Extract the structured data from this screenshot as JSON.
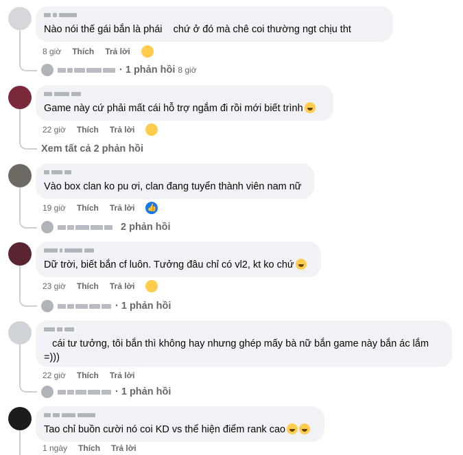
{
  "comments": [
    {
      "text": "Nào nói thế gái bắn là phái    chứ ở đó mà chê coi thường ngt chịu tht",
      "time": "8 giờ",
      "like": "Thích",
      "reply": "Trả lời",
      "reply_count": "· 1 phản hồi",
      "reply_time": "8 giờ",
      "reaction": "sad-cry-emoji"
    },
    {
      "text": "Game này cứ phải mất cái hỗ trợ ngắm đi rồi mới biết trình",
      "time": "22 giờ",
      "like": "Thích",
      "reply": "Trả lời",
      "see_all": "Xem tất cả 2 phản hồi",
      "reaction": "grin-emoji"
    },
    {
      "text": "Vào box clan ko pu ơi, clan đang tuyển thành viên nam nữ",
      "time": "19 giờ",
      "like": "Thích",
      "reply": "Trả lời",
      "reply_count": "2 phản hồi",
      "reaction": "like-icon"
    },
    {
      "text": "Dữ trời, biết bắn cf luôn. Tưởng đâu chỉ có vl2, kt ko chứ",
      "time": "23 giờ",
      "like": "Thích",
      "reply": "Trả lời",
      "reply_count": "· 1 phản hồi",
      "reaction": "grin-emoji"
    },
    {
      "text": "   cái tư tưởng, tôi bắn thì không hay nhưng ghép mấy bà nữ bắn game này bắn ác lắm\n=)))",
      "time": "22 giờ",
      "like": "Thích",
      "reply": "Trả lời",
      "reply_count": "· 1 phản hồi"
    },
    {
      "text": "Tao chỉ buồn cười nó coi KD vs thể hiện điểm rank cao",
      "time": "1 ngày",
      "like": "Thích",
      "reply": "Trả lời"
    }
  ],
  "colors": {
    "bubble": "#f0f2f5",
    "meta": "#65676b",
    "like_blue": "#1877f2",
    "emoji": "#ffcc4d"
  }
}
